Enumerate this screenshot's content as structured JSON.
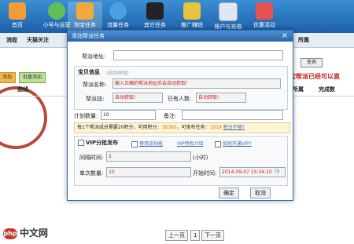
{
  "toolbar": {
    "items": [
      {
        "label": "首页",
        "color": "#f29c38"
      },
      {
        "label": "小号与运营",
        "color": "#5fbf56"
      },
      {
        "label": "淘宝任务",
        "color": "#f2a93b"
      },
      {
        "label": "流量任务",
        "color": "#4aa1e0"
      },
      {
        "label": "其它任务",
        "color": "#222222"
      },
      {
        "label": "推广赚钱",
        "color": "#e8c23a"
      },
      {
        "label": "账户与充值",
        "color": "#dfe8f2"
      },
      {
        "label": "优惠活动",
        "color": "#e45252"
      }
    ]
  },
  "main": {
    "tabs": [
      "流程",
      "天猫关注",
      "所属"
    ],
    "buttons": [
      "添加",
      "批量添加"
    ],
    "column_left": "曲线",
    "column_right": [
      "所属",
      "完成数"
    ],
    "search_button": "查询",
    "red_note": "淘宝帮派已经可以直",
    "pager": {
      "prev": "上一页",
      "page": "1",
      "next": "下一页"
    }
  },
  "dialog": {
    "title": "添加帮派任务",
    "close": "×",
    "url_label": "帮派地址:",
    "url_value": "",
    "baby_info": {
      "header": "宝贝信息",
      "hint": "(自动获取)",
      "name_label": "帮派名称:",
      "name_value": "输入正确的帮派地址后会自动获取!",
      "addr_label": "帮派加:",
      "addr_value": "自动获取!",
      "members_label": "已有人数:",
      "members_value": "自动获取!"
    },
    "plan_label": "计划数量:",
    "plan_value": "10",
    "remark_label": "备注:",
    "info_bar": {
      "text": "每1个帮派成员需要20积分，可用积分：",
      "points": "38380",
      "tasks_label": "，可发布任务：",
      "tasks": "1919",
      "link": "积分不够?"
    },
    "vip": {
      "header": "VIP分批发布",
      "options": [
        "使用该功能",
        "VIP特权介绍",
        "如何开通VIP?"
      ],
      "interval_label": "间隔时间:",
      "interval_value": "1",
      "interval_unit": "(小时)",
      "count_label": "单次数量:",
      "count_value": "10",
      "start_label": "开始时间:",
      "start_value": "2014-09-07 15:34:10"
    },
    "buttons": [
      "确定",
      "取消"
    ]
  },
  "watermark": {
    "mark": "php",
    "text": "中文网"
  }
}
